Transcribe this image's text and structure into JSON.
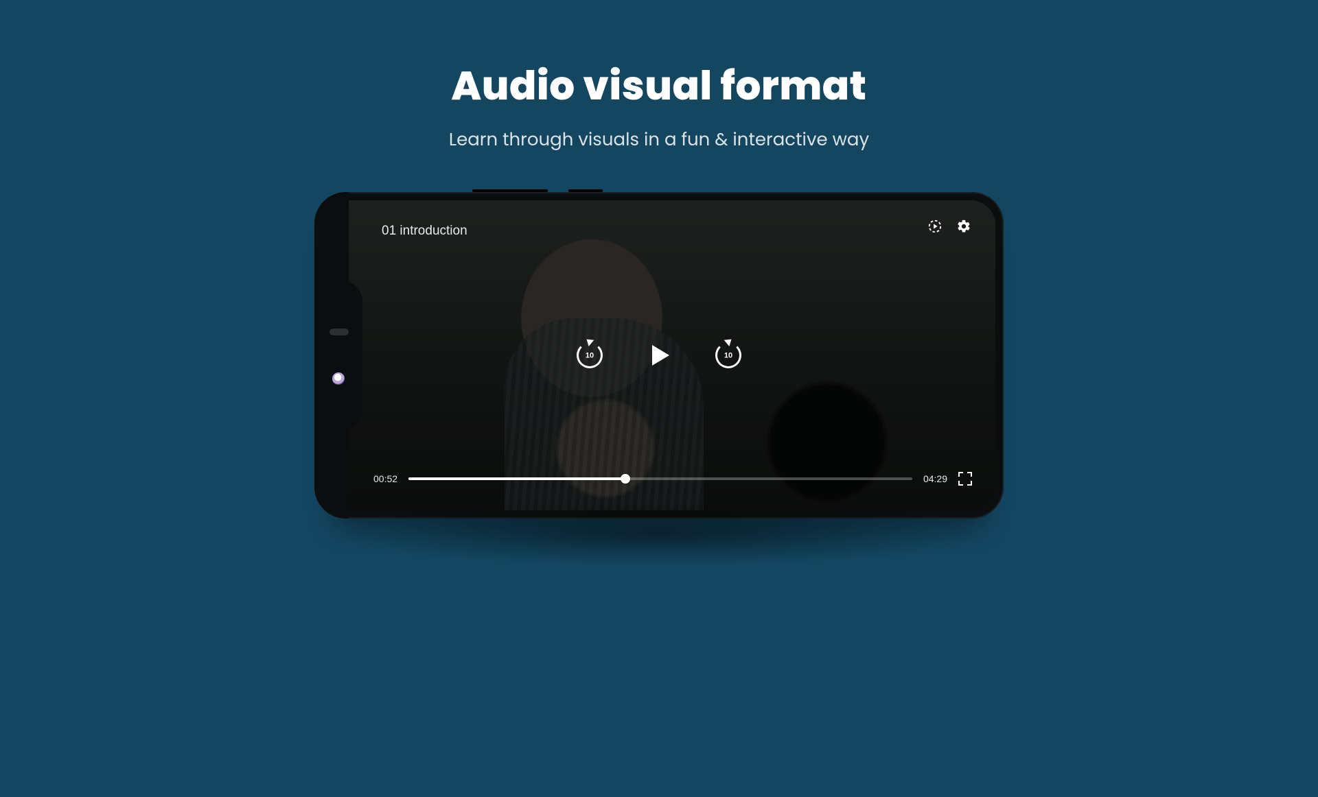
{
  "heading": {
    "title": "Audio visual format",
    "subtitle": "Learn through visuals in a fun & interactive way"
  },
  "player": {
    "lesson_title": "01 introduction",
    "seek_seconds": "10",
    "elapsed": "00:52",
    "duration": "04:29",
    "progress_percent": 43
  },
  "colors": {
    "page_bg": "#144660",
    "text_primary": "#ffffff",
    "text_secondary": "#d8e3e8"
  }
}
